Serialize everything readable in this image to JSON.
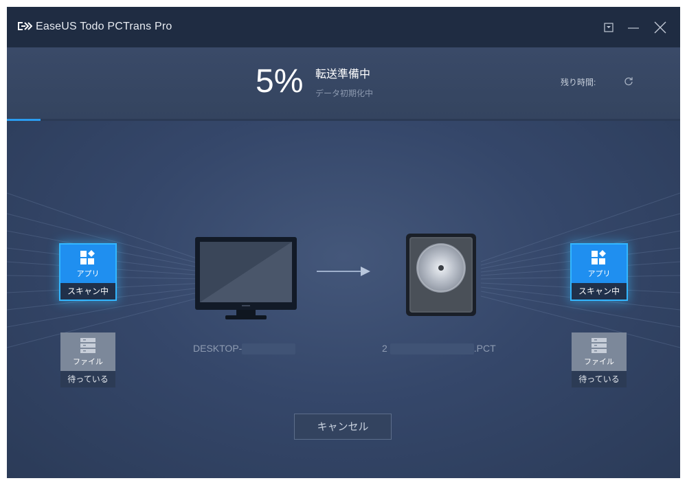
{
  "app": {
    "title": "EaseUS Todo PCTrans Pro",
    "logo_icon": "easeus-logo-icon"
  },
  "titlebar": {
    "menu_icon": "dropdown-box-icon",
    "minimize_icon": "minimize-icon",
    "close_icon": "close-icon"
  },
  "progress": {
    "percent_label": "5%",
    "value": 0.05,
    "status": "転送準備中",
    "substatus": "データ初期化中",
    "remaining_label": "残り時間:",
    "remaining_icon": "refresh-icon"
  },
  "source": {
    "pc_name": "DESKTOP-",
    "tiles": [
      {
        "label": "アプリ",
        "state": "スキャン中",
        "icon": "apps-grid-icon"
      },
      {
        "label": "ファイル",
        "state": "待っている",
        "icon": "file-stack-icon"
      }
    ]
  },
  "target": {
    "file_prefix": "2",
    "file_suffix": ".PCT",
    "tiles": [
      {
        "label": "アプリ",
        "state": "スキャン中",
        "icon": "apps-grid-icon"
      },
      {
        "label": "ファイル",
        "state": "待っている",
        "icon": "file-stack-icon"
      }
    ]
  },
  "actions": {
    "cancel_label": "キャンセル"
  },
  "colors": {
    "accent": "#1f8ff0",
    "progress": "#2a9cf0",
    "titlebar": "#1f2c42",
    "background": "#2f4160"
  }
}
